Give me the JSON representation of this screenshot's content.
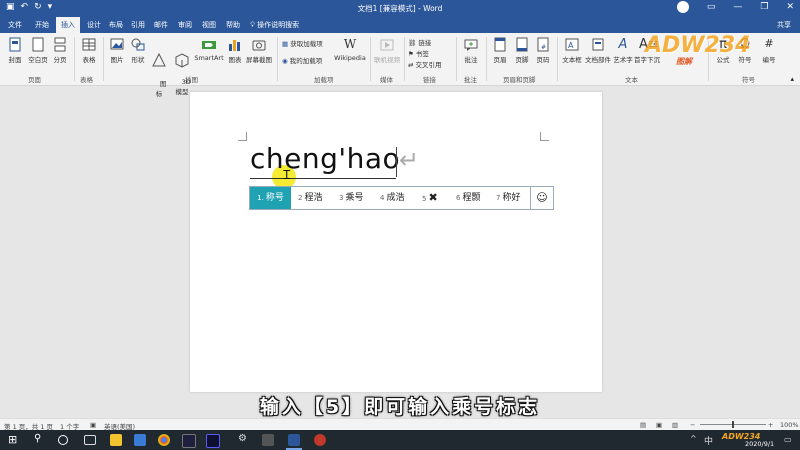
{
  "window": {
    "title": "文档1 [兼容模式] - Word",
    "share": "共享"
  },
  "tabs": [
    "文件",
    "开始",
    "插入",
    "设计",
    "布局",
    "引用",
    "邮件",
    "审阅",
    "视图",
    "帮助"
  ],
  "active_tab": "插入",
  "tell_me": "操作说明搜索",
  "ribbon": {
    "buttons": {
      "cover": "封面",
      "blank": "空白页",
      "pagebreak": "分页",
      "table": "表格",
      "pictures": "图片",
      "shapes": "形状",
      "icons": "图\n标",
      "models3d": "3D\n模型",
      "smartart": "SmartArt",
      "chart": "图表",
      "screenshot": "屏幕截图",
      "getaddins": "获取加载项",
      "myaddins": "我的加载项",
      "wikipedia": "Wikipedia",
      "onlinevideo": "联机视频",
      "link": "链接",
      "bookmark": "书签",
      "crossref": "交叉引用",
      "comment": "批注",
      "header": "页眉",
      "footer": "页脚",
      "pagenum": "页码",
      "textbox": "文本框",
      "docparts": "文档部件",
      "wordart": "艺术字",
      "dropcap": "首字下沉",
      "equation": "公式",
      "symbol": "符号",
      "number": "编号"
    },
    "groups": {
      "pages": "页面",
      "tables": "表格",
      "illustrations": "插图",
      "addins": "加载项",
      "media": "媒体",
      "links": "链接",
      "comments": "批注",
      "headerfooter": "页眉和页脚",
      "text": "文本",
      "symbols": "符号"
    }
  },
  "document": {
    "typed_text": "cheng'hao",
    "enter_mark": "↵"
  },
  "ime": {
    "candidates": [
      {
        "num": "1.",
        "text": "称号"
      },
      {
        "num": "2",
        "text": "程浩"
      },
      {
        "num": "3",
        "text": "乘号"
      },
      {
        "num": "4",
        "text": "成浩"
      },
      {
        "num": "5",
        "text": "✖"
      },
      {
        "num": "6",
        "text": "程颢"
      },
      {
        "num": "7",
        "text": "称好"
      }
    ],
    "smile": "☺"
  },
  "caption": "输入【5】即可输入乘号标志",
  "status": {
    "page": "第 1 页，共 1 页",
    "words": "1 个字",
    "lang": "英语(美国)",
    "zoom": "100%"
  },
  "taskbar": {
    "ime": "中",
    "date": "2020/9/1"
  },
  "watermark": {
    "text": "ADW234",
    "sub": "图解"
  },
  "colors": {
    "word_blue": "#2b579a",
    "ime_select": "#1fa3b3"
  }
}
